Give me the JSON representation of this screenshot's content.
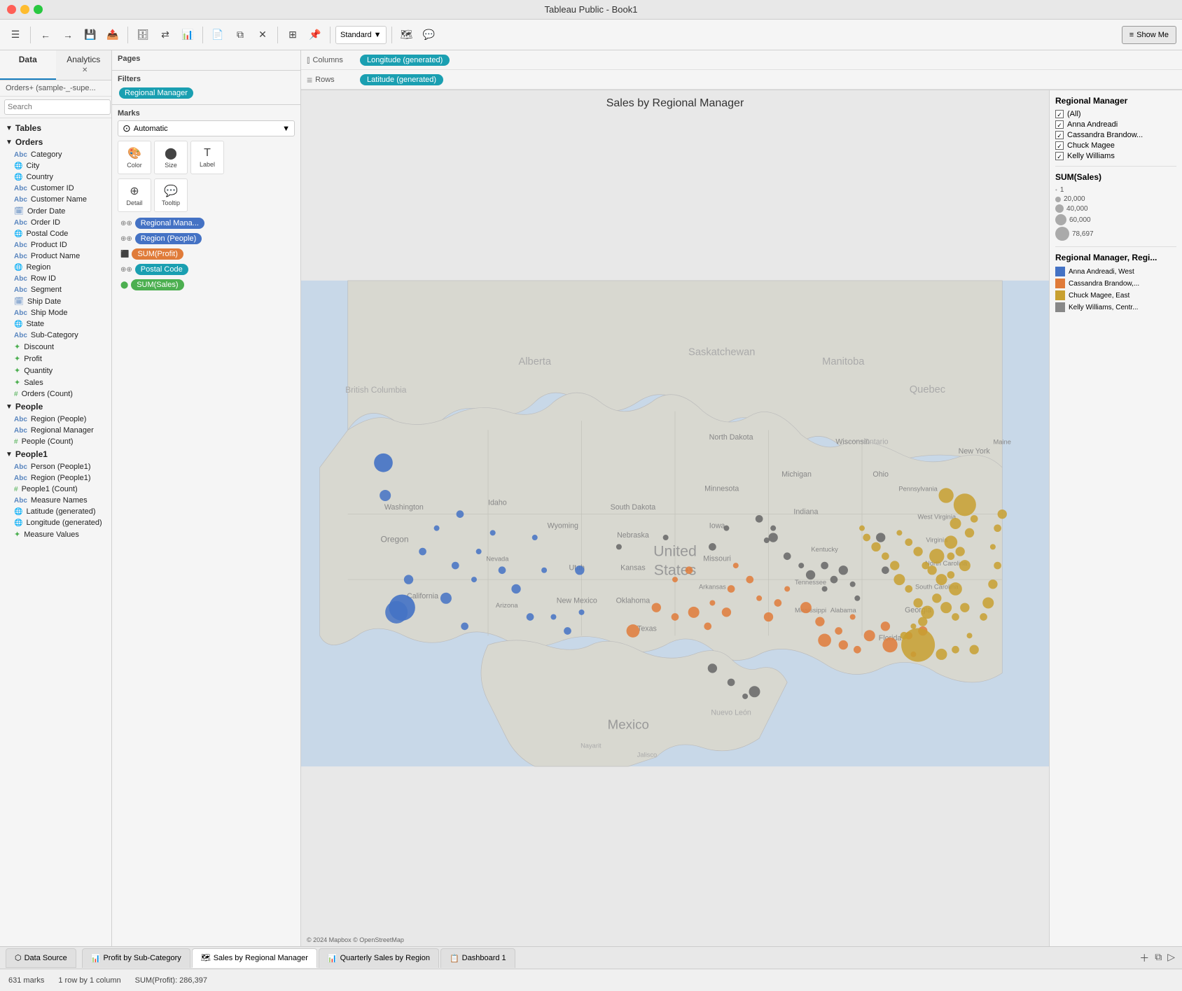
{
  "titlebar": {
    "title": "Tableau Public - Book1"
  },
  "toolbar": {
    "show_me": "Show Me"
  },
  "data_analytics_tabs": [
    {
      "label": "Data",
      "active": true
    },
    {
      "label": "Analytics",
      "active": false
    }
  ],
  "datasource": "Orders+ (sample-_-supe...",
  "search": {
    "placeholder": "Search"
  },
  "tables": {
    "orders": {
      "label": "Orders",
      "fields": [
        {
          "name": "Category",
          "type": "dim-str"
        },
        {
          "name": "City",
          "type": "dim-geo"
        },
        {
          "name": "Country",
          "type": "dim-geo"
        },
        {
          "name": "Customer ID",
          "type": "dim-str"
        },
        {
          "name": "Customer Name",
          "type": "dim-str"
        },
        {
          "name": "Order Date",
          "type": "dim-date"
        },
        {
          "name": "Order ID",
          "type": "dim-str"
        },
        {
          "name": "Postal Code",
          "type": "dim-geo"
        },
        {
          "name": "Product ID",
          "type": "dim-str"
        },
        {
          "name": "Product Name",
          "type": "dim-str"
        },
        {
          "name": "Region",
          "type": "dim-geo"
        },
        {
          "name": "Row ID",
          "type": "dim-str"
        },
        {
          "name": "Segment",
          "type": "dim-str"
        },
        {
          "name": "Ship Date",
          "type": "dim-date"
        },
        {
          "name": "Ship Mode",
          "type": "dim-str"
        },
        {
          "name": "State",
          "type": "dim-geo"
        },
        {
          "name": "Sub-Category",
          "type": "dim-str"
        },
        {
          "name": "Discount",
          "type": "measure"
        },
        {
          "name": "Profit",
          "type": "measure"
        },
        {
          "name": "Quantity",
          "type": "measure"
        },
        {
          "name": "Sales",
          "type": "measure"
        },
        {
          "name": "Orders (Count)",
          "type": "measure-cnt"
        }
      ]
    },
    "people": {
      "label": "People",
      "fields": [
        {
          "name": "Region (People)",
          "type": "dim-str"
        },
        {
          "name": "Regional Manager",
          "type": "dim-str"
        },
        {
          "name": "People (Count)",
          "type": "measure-cnt"
        }
      ]
    },
    "people1": {
      "label": "People1",
      "fields": [
        {
          "name": "Person (People1)",
          "type": "dim-str"
        },
        {
          "name": "Region (People1)",
          "type": "dim-str"
        },
        {
          "name": "People1 (Count)",
          "type": "measure-cnt"
        }
      ]
    },
    "misc": [
      {
        "name": "Measure Names",
        "type": "dim-str"
      },
      {
        "name": "Latitude (generated)",
        "type": "dim-geo"
      },
      {
        "name": "Longitude (generated)",
        "type": "dim-geo"
      },
      {
        "name": "Measure Values",
        "type": "measure"
      }
    ]
  },
  "pages": {
    "label": "Pages"
  },
  "filters": {
    "label": "Filters",
    "items": [
      "Regional Manager"
    ]
  },
  "marks": {
    "label": "Marks",
    "type": "Automatic",
    "buttons": [
      {
        "label": "Color",
        "icon": "🎨"
      },
      {
        "label": "Size",
        "icon": "⬤"
      },
      {
        "label": "Label",
        "icon": "T"
      }
    ],
    "detail_buttons": [
      {
        "label": "Detail",
        "icon": "⊕"
      },
      {
        "label": "Tooltip",
        "icon": "💬"
      }
    ],
    "pills": [
      {
        "label": "Regional Mana...",
        "color": "blue",
        "icon": "⊕⊕"
      },
      {
        "label": "Region (People)",
        "color": "blue",
        "icon": "⊕⊕"
      },
      {
        "label": "SUM(Profit)",
        "color": "orange",
        "icon": "⬛"
      },
      {
        "label": "Postal Code",
        "color": "teal",
        "icon": "⊕⊕"
      },
      {
        "label": "SUM(Sales)",
        "color": "green",
        "icon": "⬤"
      }
    ]
  },
  "shelf": {
    "columns_label": "Columns",
    "columns_pill": "Longitude (generated)",
    "rows_label": "Rows",
    "rows_pill": "Latitude (generated)"
  },
  "chart": {
    "title": "Sales by Regional Manager"
  },
  "legend": {
    "manager_title": "Regional Manager",
    "manager_items": [
      {
        "label": "(All)",
        "checked": true
      },
      {
        "label": "Anna Andreadi",
        "checked": true
      },
      {
        "label": "Cassandra Brandow...",
        "checked": true
      },
      {
        "label": "Chuck Magee",
        "checked": true
      },
      {
        "label": "Kelly Williams",
        "checked": true
      }
    ],
    "sales_title": "SUM(Sales)",
    "sales_sizes": [
      {
        "label": "1",
        "size": 4
      },
      {
        "label": "20,000",
        "size": 8
      },
      {
        "label": "40,000",
        "size": 12
      },
      {
        "label": "60,000",
        "size": 16
      },
      {
        "label": "78,697",
        "size": 20
      }
    ],
    "color_title": "Regional Manager, Regi...",
    "color_items": [
      {
        "label": "Anna Andreadi, West",
        "color": "#4472c4"
      },
      {
        "label": "Cassandra Brandow,...",
        "color": "#e07b39"
      },
      {
        "label": "Chuck Magee, East",
        "color": "#c8a030"
      },
      {
        "label": "Kelly Williams, Centr...",
        "color": "#888888"
      }
    ]
  },
  "bottom_tabs": [
    {
      "label": "Data Source",
      "active": false,
      "icon": "⬡"
    },
    {
      "label": "Profit by Sub-Category",
      "active": false,
      "icon": "📊"
    },
    {
      "label": "Sales by Regional Manager",
      "active": true,
      "icon": "🗺"
    },
    {
      "label": "Quarterly Sales by Region",
      "active": false,
      "icon": "📊"
    },
    {
      "label": "Dashboard 1",
      "active": false,
      "icon": "📋"
    }
  ],
  "status_bar": {
    "marks": "631 marks",
    "layout": "1 row by 1 column",
    "sum_profit": "SUM(Profit): 286,397"
  },
  "map_credit": "© 2024 Mapbox © OpenStreetMap"
}
